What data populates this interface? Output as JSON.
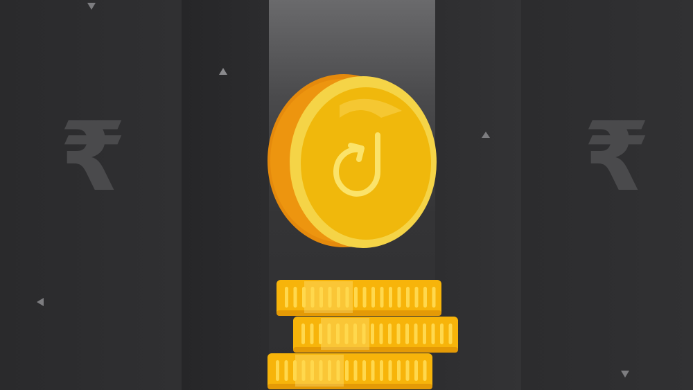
{
  "background": {
    "rupee_symbol": "₹",
    "colors": {
      "base": "#2b2b2d",
      "spotlight": "#6a6a6c",
      "symbol": "#4a4a4c",
      "triangle": "#7d7d80"
    }
  },
  "coin": {
    "logo_glyph": "d-arrow-logo",
    "colors": {
      "face": "#f0b80c",
      "rim": "#f5d447",
      "edge": "#e58a0c",
      "logo": "#fbe36a"
    }
  },
  "coin_stack": {
    "coin_count": 3,
    "colors": {
      "face": "#f7b40a",
      "ridge": "#ffd84d",
      "shadow": "#e49a06"
    }
  }
}
